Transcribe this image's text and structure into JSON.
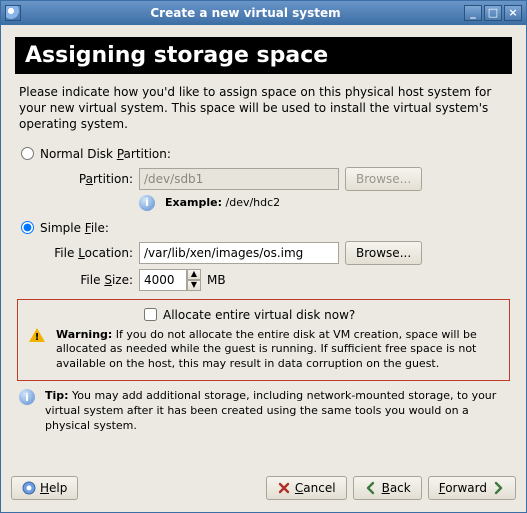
{
  "window": {
    "title": "Create a new virtual system"
  },
  "heading": "Assigning storage space",
  "intro": "Please indicate how you'd like to assign space on this physical host system for your new virtual system. This space will be used to install the virtual system's operating system.",
  "option_normal": {
    "label_pre": "Normal Disk ",
    "label_key": "P",
    "label_post": "artition:",
    "partition_label_pre": "P",
    "partition_label_key": "a",
    "partition_label_post": "rtition:",
    "partition_value": "/dev/sdb1",
    "browse_label": "Browse...",
    "example_prefix": "Example:",
    "example_value": "/dev/hdc2"
  },
  "option_simple": {
    "label_pre": "Simple ",
    "label_key": "F",
    "label_post": "ile:",
    "loc_label_pre": "File ",
    "loc_label_key": "L",
    "loc_label_post": "ocation:",
    "loc_value": "/var/lib/xen/images/os.img",
    "browse_label": "Browse...",
    "size_label_pre": "File ",
    "size_label_key": "S",
    "size_label_post": "ize:",
    "size_value": "4000",
    "size_unit": "MB",
    "allocate_label": "Allocate entire virtual disk now?"
  },
  "warning": {
    "prefix": "Warning:",
    "text": " If you do not allocate the entire disk at VM creation, space will be allocated as needed while the guest is running. If sufficient free space is not available on the host, this may result in data corruption on the guest."
  },
  "tip": {
    "prefix": "Tip:",
    "text": " You may add additional storage, including network-mounted storage, to your virtual system after it has been created using the same tools you would on a physical system."
  },
  "buttons": {
    "help_key": "H",
    "help_post": "elp",
    "cancel_key": "C",
    "cancel_post": "ancel",
    "back_key": "B",
    "back_post": "ack",
    "forward_key": "F",
    "forward_post": "orward"
  }
}
